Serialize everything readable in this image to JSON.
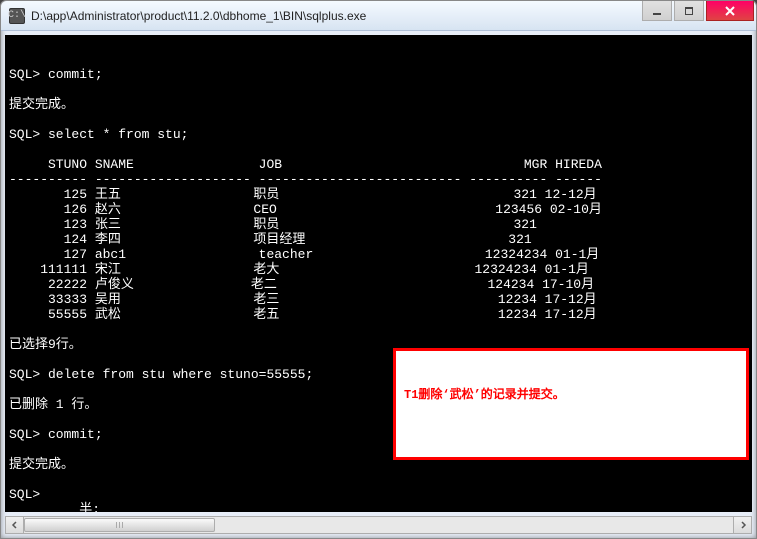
{
  "titlebar": {
    "icon_label": "C:\\",
    "title": "D:\\app\\Administrator\\product\\11.2.0\\dbhome_1\\BIN\\sqlplus.exe"
  },
  "window_controls": {
    "minimize": "–",
    "maximize": "□",
    "close": "×"
  },
  "terminal": {
    "lines": [
      "SQL> commit;",
      "",
      "提交完成。",
      "",
      "SQL> select * from stu;",
      "",
      "     STUNO SNAME                JOB                               MGR HIREDA",
      "---------- -------------------- -------------------------- ---------- ------",
      "       125 王五                 职员                              321 12-12月",
      "       126 赵六                 CEO                            123456 02-10月",
      "       123 张三                 职员                              321",
      "       124 李四                 项目经理                          321",
      "       127 abc1                 teacher                      12324234 01-1月",
      "    111111 宋江                 老大                         12324234 01-1月",
      "     22222 卢俊义               老二                           124234 17-10月",
      "     33333 吴用                 老三                            12234 17-12月",
      "     55555 武松                 老五                            12234 17-12月",
      "",
      "已选择9行。",
      "",
      "SQL> delete from stu where stuno=55555;",
      "",
      "已删除 1 行。",
      "",
      "SQL> commit;",
      "",
      "提交完成。",
      "",
      "SQL>",
      "         半:"
    ]
  },
  "chart_data": {
    "type": "table",
    "columns": [
      "STUNO",
      "SNAME",
      "JOB",
      "MGR",
      "HIREDA"
    ],
    "rows": [
      {
        "STUNO": 125,
        "SNAME": "王五",
        "JOB": "职员",
        "MGR": 321,
        "HIREDA": "12-12月"
      },
      {
        "STUNO": 126,
        "SNAME": "赵六",
        "JOB": "CEO",
        "MGR": 123456,
        "HIREDA": "02-10月"
      },
      {
        "STUNO": 123,
        "SNAME": "张三",
        "JOB": "职员",
        "MGR": 321,
        "HIREDA": null
      },
      {
        "STUNO": 124,
        "SNAME": "李四",
        "JOB": "项目经理",
        "MGR": 321,
        "HIREDA": null
      },
      {
        "STUNO": 127,
        "SNAME": "abc1",
        "JOB": "teacher",
        "MGR": 12324234,
        "HIREDA": "01-1月"
      },
      {
        "STUNO": 111111,
        "SNAME": "宋江",
        "JOB": "老大",
        "MGR": 12324234,
        "HIREDA": "01-1月"
      },
      {
        "STUNO": 22222,
        "SNAME": "卢俊义",
        "JOB": "老二",
        "MGR": 124234,
        "HIREDA": "17-10月"
      },
      {
        "STUNO": 33333,
        "SNAME": "吴用",
        "JOB": "老三",
        "MGR": 12234,
        "HIREDA": "17-12月"
      },
      {
        "STUNO": 55555,
        "SNAME": "武松",
        "JOB": "老五",
        "MGR": 12234,
        "HIREDA": "17-12月"
      }
    ]
  },
  "annotation": {
    "text": "T1删除‘武松’的记录并提交。"
  },
  "scrollbar": {
    "thumb_width_ratio": 0.27,
    "thumb_left_ratio": 0.0
  }
}
